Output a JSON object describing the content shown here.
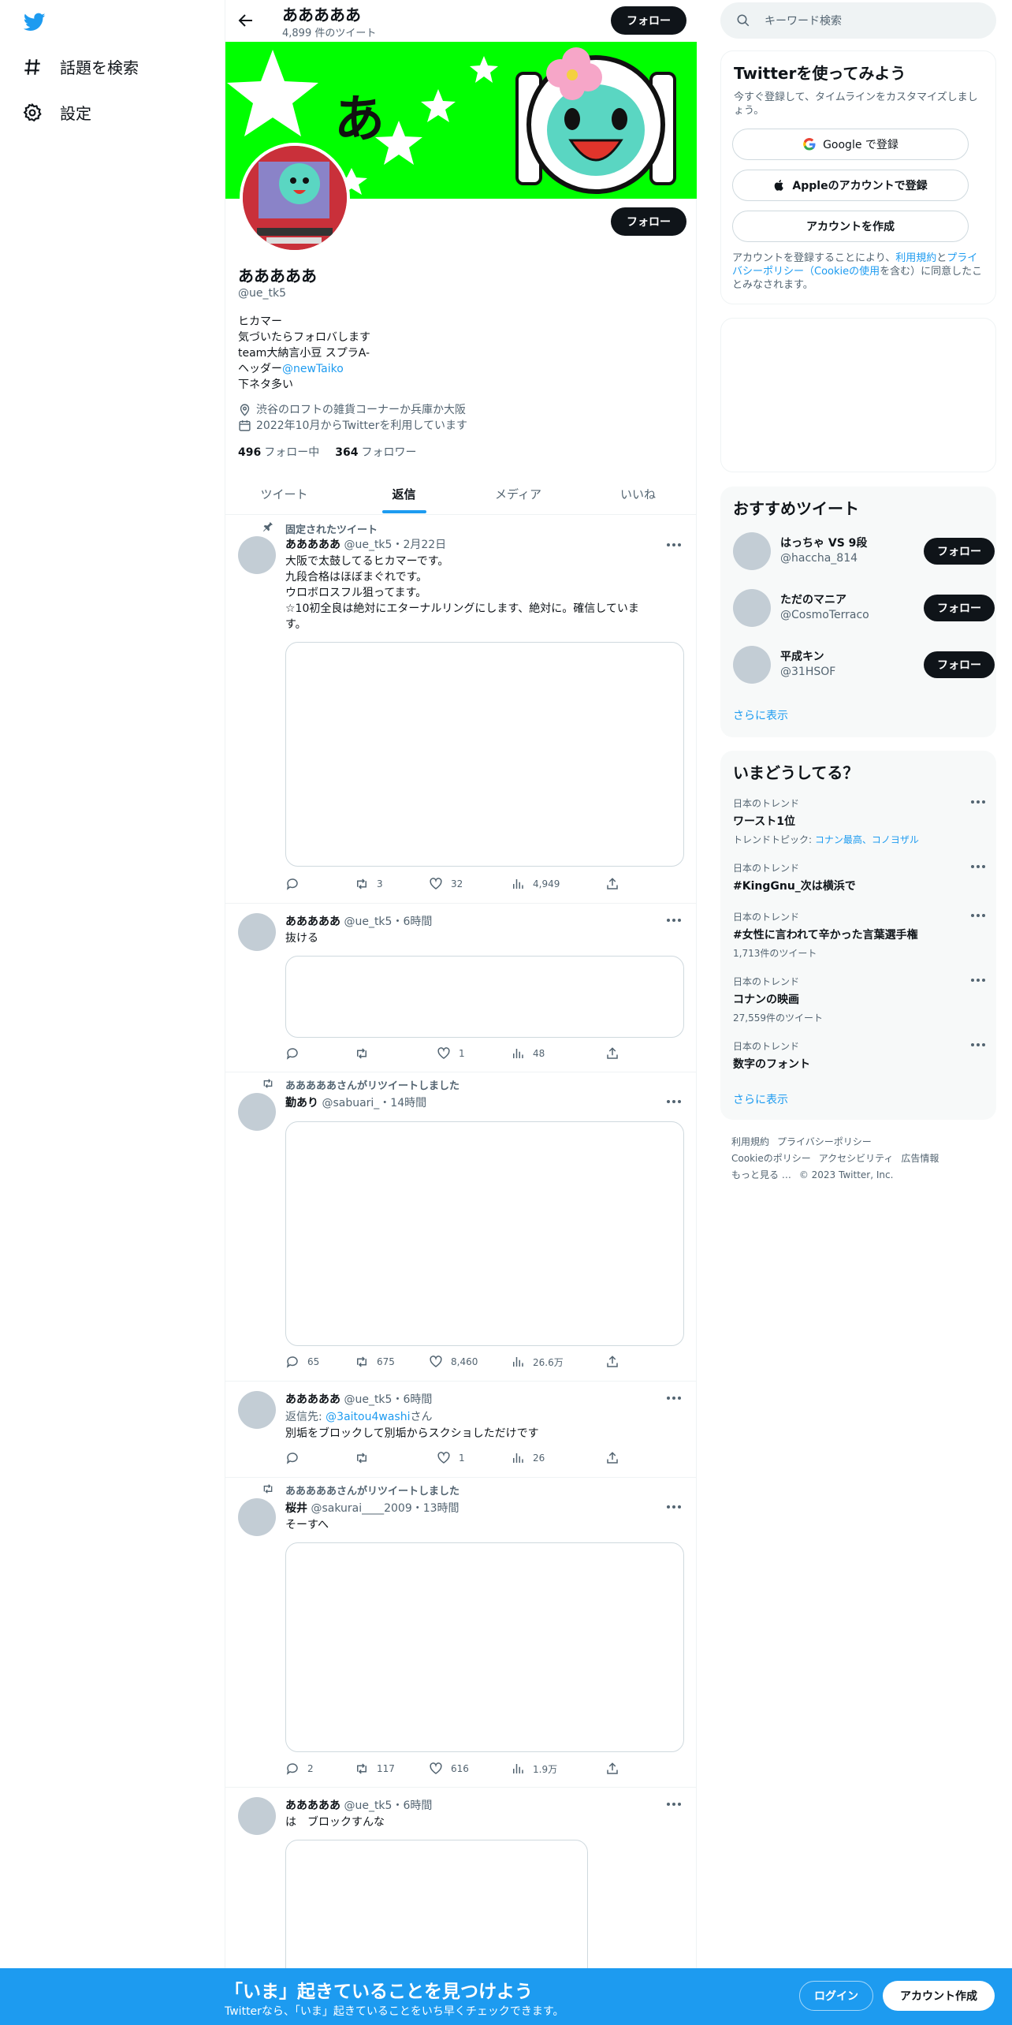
{
  "nav": {
    "explore_label": "話題を検索",
    "settings_label": "設定"
  },
  "header": {
    "name": "あああああ",
    "tweet_count": "4,899 件のツイート",
    "follow_label": "フォロー"
  },
  "profile": {
    "banner_text": "あ",
    "name": "あああああ",
    "handle": "@ue_tk5",
    "follow_label": "フォロー",
    "bio": {
      "line1": "ヒカマー",
      "line2": "気づいたらフォロバします",
      "line3": "team大納言小豆 スプラA-",
      "line4_prefix": "ヘッダー",
      "line4_link": "@newTaiko",
      "line5": "下ネタ多い"
    },
    "location": "渋谷のロフトの雑貨コーナーか兵庫か大阪",
    "joined": "2022年10月からTwitterを利用しています",
    "following_count": "496",
    "following_label": "フォロー中",
    "followers_count": "364",
    "followers_label": "フォロワー"
  },
  "tabs": [
    "ツイート",
    "返信",
    "メディア",
    "いいね"
  ],
  "tweets": [
    {
      "pinned_label": "固定されたツイート",
      "name": "あああああ",
      "meta": "@ue_tk5・2月22日",
      "lines": [
        "大阪で太鼓してるヒカマーです。",
        "九段合格はほぼまぐれです。",
        "ウロボロスフル狙ってます。",
        "☆10初全良は絶対にエターナルリングにします、絶対に。確信していま",
        "す。"
      ],
      "reply": "",
      "retweet": "3",
      "like": "32",
      "views": "4,949"
    },
    {
      "name": "あああああ",
      "meta": "@ue_tk5・6時間",
      "lines": [
        "抜ける"
      ],
      "reply": "",
      "retweet": "",
      "like": "1",
      "views": "48"
    },
    {
      "retweeted_by": "あああああさんがリツイートしました",
      "name": "勤あり",
      "meta": "@sabuari_・14時間",
      "reply": "65",
      "retweet": "675",
      "like": "8,460",
      "views": "26.6万"
    },
    {
      "name": "あああああ",
      "meta": "@ue_tk5・6時間",
      "reply_to_prefix": "返信先: ",
      "reply_to_handle": "@3aitou4washi",
      "reply_to_suffix": "さん",
      "lines": [
        "別垢をブロックして別垢からスクショしただけです"
      ],
      "reply": "",
      "retweet": "",
      "like": "1",
      "views": "26"
    },
    {
      "retweeted_by": "あああああさんがリツイートしました",
      "name": "桜井",
      "meta": "@sakurai____2009・13時間",
      "lines": [
        "そーすへ"
      ],
      "reply": "2",
      "retweet": "117",
      "like": "616",
      "views": "1.9万"
    },
    {
      "name": "あああああ",
      "meta": "@ue_tk5・6時間",
      "lines": [
        "は　ブロックすんな"
      ]
    }
  ],
  "right": {
    "search_placeholder": "キーワード検索",
    "signup": {
      "title": "Twitterを使ってみよう",
      "desc_line1": "今すぐ登録して、タイムラインをカスタマイズしまし",
      "desc_line2": "ょう。",
      "google_label": "Google で登録",
      "apple_label": "Appleのアカウントで登録",
      "create_label": "アカウントを作成",
      "terms_line1_a": "アカウントを登録することにより、",
      "terms_line1_link": "利用規約",
      "terms_line1_b": "と",
      "terms_line1_link2": "プライ",
      "terms_line2_link": "バシーポリシー（Cookieの使用",
      "terms_line2_b": "を含む）に同意したこ",
      "terms_line3": "とみなされます。"
    },
    "recommended": {
      "title": "おすすめツイート",
      "users": [
        {
          "name": "はっちゃ VS 9段",
          "handle": "@haccha_814"
        },
        {
          "name": "ただのマニア",
          "handle": "@CosmoTerraco"
        },
        {
          "name": "平成キン",
          "handle": "@31HSOF"
        }
      ],
      "follow_label": "フォロー",
      "show_more": "さらに表示"
    },
    "trends": {
      "title": "いまどうしてる？",
      "items": [
        {
          "cat": "日本のトレンド",
          "name": "ワースト1位",
          "sub_prefix": "トレンドトピック: ",
          "sub_link": "コナン最高、コノヨザル"
        },
        {
          "cat": "日本のトレンド",
          "name": "#KingGnu_次は横浜で"
        },
        {
          "cat": "日本のトレンド",
          "name": "#女性に言われて辛かった言葉選手権",
          "sub": "1,713件のツイート"
        },
        {
          "cat": "日本のトレンド",
          "name": "コナンの映画",
          "sub": "27,559件のツイート"
        },
        {
          "cat": "日本のトレンド",
          "name": "数字のフォント"
        }
      ],
      "show_more": "さらに表示"
    },
    "footer": {
      "terms": "利用規約",
      "privacy": "プライバシーポリシー",
      "cookie": "Cookieのポリシー",
      "accessibility": "アクセシビリティ",
      "ads": "広告情報",
      "more": "もっと見る …",
      "copyright": "© 2023 Twitter, Inc."
    }
  },
  "bottom": {
    "title": "「いま」起きていることを見つけよう",
    "sub": "Twitterなら、「いま」起きていることをいち早くチェックできます。",
    "login": "ログイン",
    "signup": "アカウント作成"
  },
  "colors": {
    "accent": "#1d9bf0",
    "banner_bg": "#00ff00",
    "text": "#0f1419",
    "secondary": "#536471"
  }
}
